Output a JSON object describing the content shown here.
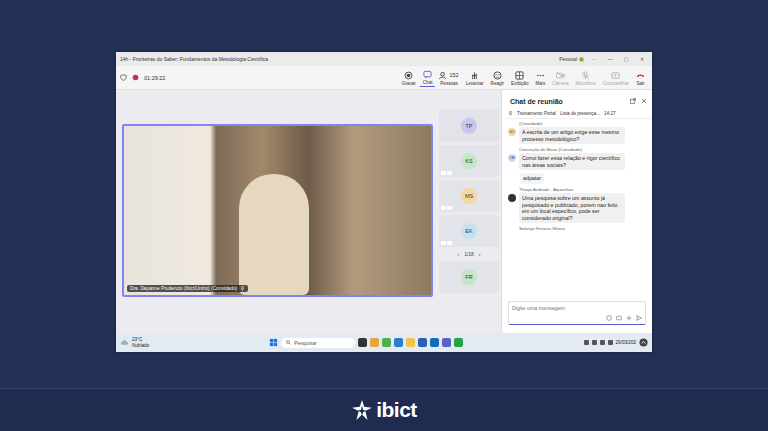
{
  "window": {
    "title": "14h - Fronteiras do Saber: Fundamentos da Metodologia Científica",
    "profile": "Pessoal",
    "controls": [
      "···",
      "—",
      "▢",
      "✕"
    ]
  },
  "toolbar": {
    "recording": true,
    "timer": "01:29:22",
    "buttons": [
      {
        "label": "Gravar",
        "count": "",
        "selected": false,
        "disabled": false,
        "kind": "normal"
      },
      {
        "label": "Chat",
        "count": "",
        "selected": true,
        "disabled": false,
        "kind": "normal"
      },
      {
        "label": "Pessoas",
        "count": "152",
        "selected": false,
        "disabled": false,
        "kind": "normal"
      },
      {
        "label": "Levantar",
        "count": "",
        "selected": false,
        "disabled": false,
        "kind": "normal"
      },
      {
        "label": "Reagir",
        "count": "",
        "selected": false,
        "disabled": false,
        "kind": "normal"
      },
      {
        "label": "Exibição",
        "count": "",
        "selected": false,
        "disabled": false,
        "kind": "normal"
      },
      {
        "label": "Mais",
        "count": "",
        "selected": false,
        "disabled": false,
        "kind": "normal"
      },
      {
        "label": "Câmera",
        "count": "",
        "selected": false,
        "disabled": true,
        "kind": "normal"
      },
      {
        "label": "Microfone",
        "count": "",
        "selected": false,
        "disabled": true,
        "kind": "normal"
      },
      {
        "label": "Compartilhar",
        "count": "",
        "selected": false,
        "disabled": true,
        "kind": "normal"
      },
      {
        "label": "Sair",
        "count": "",
        "selected": false,
        "disabled": false,
        "kind": "leave"
      }
    ]
  },
  "stage": {
    "speaker_label": "Dra. Dayanne Prudencio (Ibict/Unirio) (Convidado)"
  },
  "participants": [
    {
      "initials": "TP",
      "color": "#c9c5f2",
      "muted": false
    },
    {
      "initials": "KS",
      "color": "#c7e6c4",
      "muted": true
    },
    {
      "initials": "MS",
      "color": "#f3d9a1",
      "muted": true
    },
    {
      "initials": "EK",
      "color": "#c8e1f1",
      "muted": true
    },
    {
      "initials": "FR",
      "color": "#c6e5c6",
      "muted": false
    }
  ],
  "pager": {
    "prev": "‹",
    "page": "1/18",
    "next": "›"
  },
  "chat": {
    "title": "Chat de reunião",
    "pinned": [
      "Treinamento Portal",
      "Lista de presença...",
      "14:27"
    ],
    "messages": [
      {
        "kind": "message",
        "sender": "(Convidado)",
        "avatar": "GC",
        "color": "#f3d9a1",
        "text": "A escrita de um artigo exige esse mesmo processo metodológico?"
      },
      {
        "kind": "message",
        "sender": "Conceição de Maria (Convidado)",
        "avatar": "CM",
        "color": "#c8e1f1",
        "text": "Como fazer essa relação e rigor científico nas áreas sociais?"
      },
      {
        "kind": "reply",
        "sender": "",
        "avatar": "",
        "color": "#ffffff",
        "text": "adpatar"
      },
      {
        "kind": "message",
        "sender": "Thiago Andrade - Aquarelize",
        "avatar": "",
        "color": "#333333",
        "text": "Uma pesquisa sobre um assunto já pesquisado e publicado, porem nao feito em um local específico, pode ser considerado original?"
      },
      {
        "kind": "sender-only",
        "sender": "Solange Ferreira Silvino",
        "avatar": "",
        "color": "#ffffff",
        "text": ""
      }
    ],
    "input_placeholder": "Digite uma mensagem"
  },
  "taskbar": {
    "temperature": "23°C",
    "weather": "Nublado",
    "search": "Pesquisar",
    "date": "29/03/202"
  },
  "footer": {
    "logo": "ibict"
  }
}
